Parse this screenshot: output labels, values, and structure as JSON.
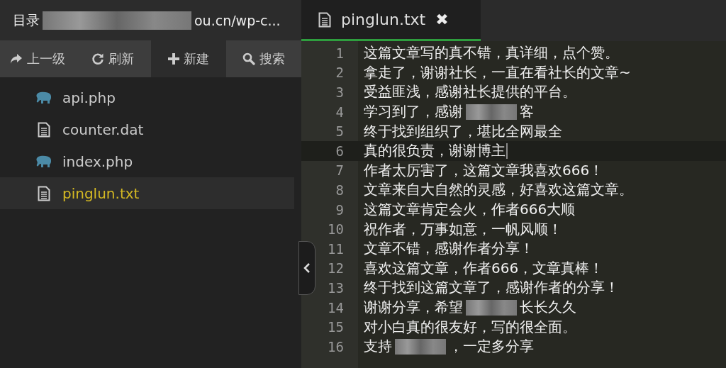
{
  "sidebar": {
    "path_parts": [
      "目录",
      "ou.cn/wp-c..."
    ],
    "toolbar": [
      {
        "label": "上一级",
        "kind": "up",
        "selected": false
      },
      {
        "label": "刷新",
        "kind": "refresh",
        "selected": false
      },
      {
        "label": "新建",
        "kind": "new",
        "selected": true
      },
      {
        "label": "搜索",
        "kind": "search",
        "selected": false
      }
    ],
    "files": [
      {
        "name": "api.php",
        "kind": "php",
        "selected": false
      },
      {
        "name": "counter.dat",
        "kind": "text",
        "selected": false
      },
      {
        "name": "index.php",
        "kind": "php",
        "selected": false
      },
      {
        "name": "pinglun.txt",
        "kind": "text",
        "selected": true
      }
    ]
  },
  "editor": {
    "tab": {
      "label": "pinglun.txt",
      "close": "✖"
    },
    "lines": [
      {
        "number": "1",
        "parts": [
          "这篇文章写的真不错，真详细，点个赞。"
        ],
        "current": false
      },
      {
        "number": "2",
        "parts": [
          "拿走了，谢谢社长，一直在看社长的文章~"
        ],
        "current": false
      },
      {
        "number": "3",
        "parts": [
          "受益匪浅，感谢社长提供的平台。"
        ],
        "current": false
      },
      {
        "number": "4",
        "parts": [
          "学习到了，感谢",
          "客"
        ],
        "current": false
      },
      {
        "number": "5",
        "parts": [
          "终于找到组织了，堪比全网最全"
        ],
        "current": false
      },
      {
        "number": "6",
        "parts": [
          "真的很负责，谢谢博主"
        ],
        "current": true
      },
      {
        "number": "7",
        "parts": [
          "作者太厉害了，这篇文章我喜欢666！"
        ],
        "current": false
      },
      {
        "number": "8",
        "parts": [
          "文章来自大自然的灵感，好喜欢这篇文章。"
        ],
        "current": false
      },
      {
        "number": "9",
        "parts": [
          "这篇文章肯定会火，作者666大顺"
        ],
        "current": false
      },
      {
        "number": "10",
        "parts": [
          "祝作者，万事如意，一帆风顺！"
        ],
        "current": false
      },
      {
        "number": "11",
        "parts": [
          "文章不错，感谢作者分享！"
        ],
        "current": false
      },
      {
        "number": "12",
        "parts": [
          "喜欢这篇文章，作者666，文章真棒！"
        ],
        "current": false
      },
      {
        "number": "13",
        "parts": [
          "终于找到这篇文章了，感谢作者的分享！"
        ],
        "current": false
      },
      {
        "number": "14",
        "parts": [
          "谢谢分享，希望",
          "长长久久"
        ],
        "current": false
      },
      {
        "number": "15",
        "parts": [
          "对小白真的很友好，写的很全面。"
        ],
        "current": false
      },
      {
        "number": "16",
        "parts": [
          "支持",
          "，一定多分享"
        ],
        "current": false
      }
    ]
  }
}
